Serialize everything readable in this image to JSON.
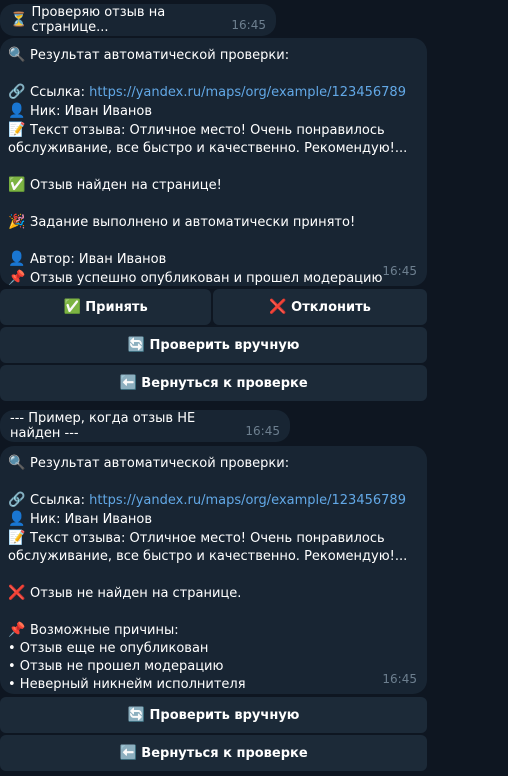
{
  "msg1": {
    "text": "Проверяю отзыв на странице...",
    "time": "16:45"
  },
  "msg2": {
    "header": "Результат автоматической проверки:",
    "link_label": "Ссылка: ",
    "link_url": "https://yandex.ru/maps/org/example/123456789",
    "nick": "Ник: Иван Иванов",
    "review_1": "Текст отзыва: Отличное место! Очень понравилось",
    "review_2": "обслуживание, все быстро и качественно. Рекомендую!...",
    "found": "Отзыв найден на странице!",
    "done": "Задание выполнено и автоматически принято!",
    "author": "Автор: Иван Иванов",
    "published": "Отзыв успешно опубликован и прошел модерацию",
    "time": "16:45"
  },
  "buttons1": {
    "accept": "Принять",
    "reject": "Отклонить",
    "check_manual": "Проверить вручную",
    "back": "Вернуться к проверке"
  },
  "msg3": {
    "text": "--- Пример, когда отзыв НЕ найден ---",
    "time": "16:45"
  },
  "msg4": {
    "header": "Результат автоматической проверки:",
    "link_label": "Ссылка: ",
    "link_url": "https://yandex.ru/maps/org/example/123456789",
    "nick": "Ник: Иван Иванов",
    "review_1": "Текст отзыва: Отличное место! Очень понравилось",
    "review_2": "обслуживание, все быстро и качественно. Рекомендую!...",
    "not_found": "Отзыв не найден на странице.",
    "reasons_title": "Возможные причины:",
    "reason_1": "• Отзыв еще не опубликован",
    "reason_2": "• Отзыв не прошел модерацию",
    "reason_3": "• Неверный никнейм исполнителя",
    "time": "16:45"
  },
  "buttons2": {
    "check_manual": "Проверить вручную",
    "back": "Вернуться к проверке"
  },
  "colors": {
    "background": "#0e1621",
    "bubble": "#182533",
    "button": "#1c2a38",
    "link": "#62a8e6"
  }
}
